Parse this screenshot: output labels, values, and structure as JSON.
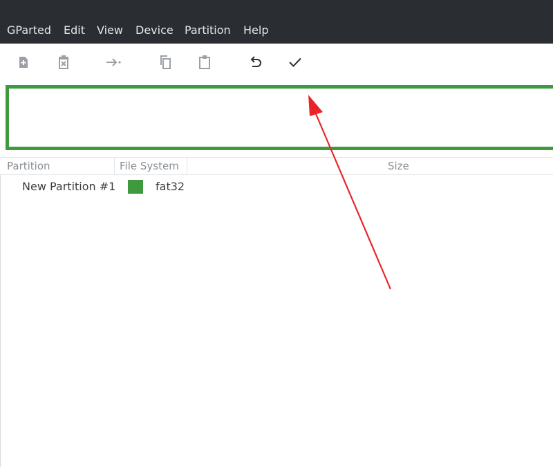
{
  "menubar": {
    "items": [
      {
        "label": "GParted"
      },
      {
        "label": "Edit"
      },
      {
        "label": "View"
      },
      {
        "label": "Device"
      },
      {
        "label": "Partition"
      },
      {
        "label": "Help"
      }
    ]
  },
  "toolbar": {
    "buttons": [
      {
        "icon": "new-partition-icon",
        "enabled": false
      },
      {
        "icon": "delete-partition-icon",
        "enabled": false
      },
      {
        "icon": "resize-move-icon",
        "enabled": false
      },
      {
        "icon": "copy-icon",
        "enabled": false
      },
      {
        "icon": "paste-icon",
        "enabled": false
      },
      {
        "icon": "undo-icon",
        "enabled": true
      },
      {
        "icon": "apply-checkmark-icon",
        "enabled": true
      }
    ]
  },
  "disk_map": {
    "partition_color": "#3f9a3f"
  },
  "partition_list": {
    "columns": [
      "Partition",
      "File System",
      "Size"
    ],
    "rows": [
      {
        "partition": "New Partition #1",
        "file_system": "fat32",
        "fs_color": "#3f9a3f",
        "size": ""
      }
    ]
  },
  "annotation": {
    "arrow_color": "#e8262a",
    "points_to": "apply-checkmark-icon"
  }
}
